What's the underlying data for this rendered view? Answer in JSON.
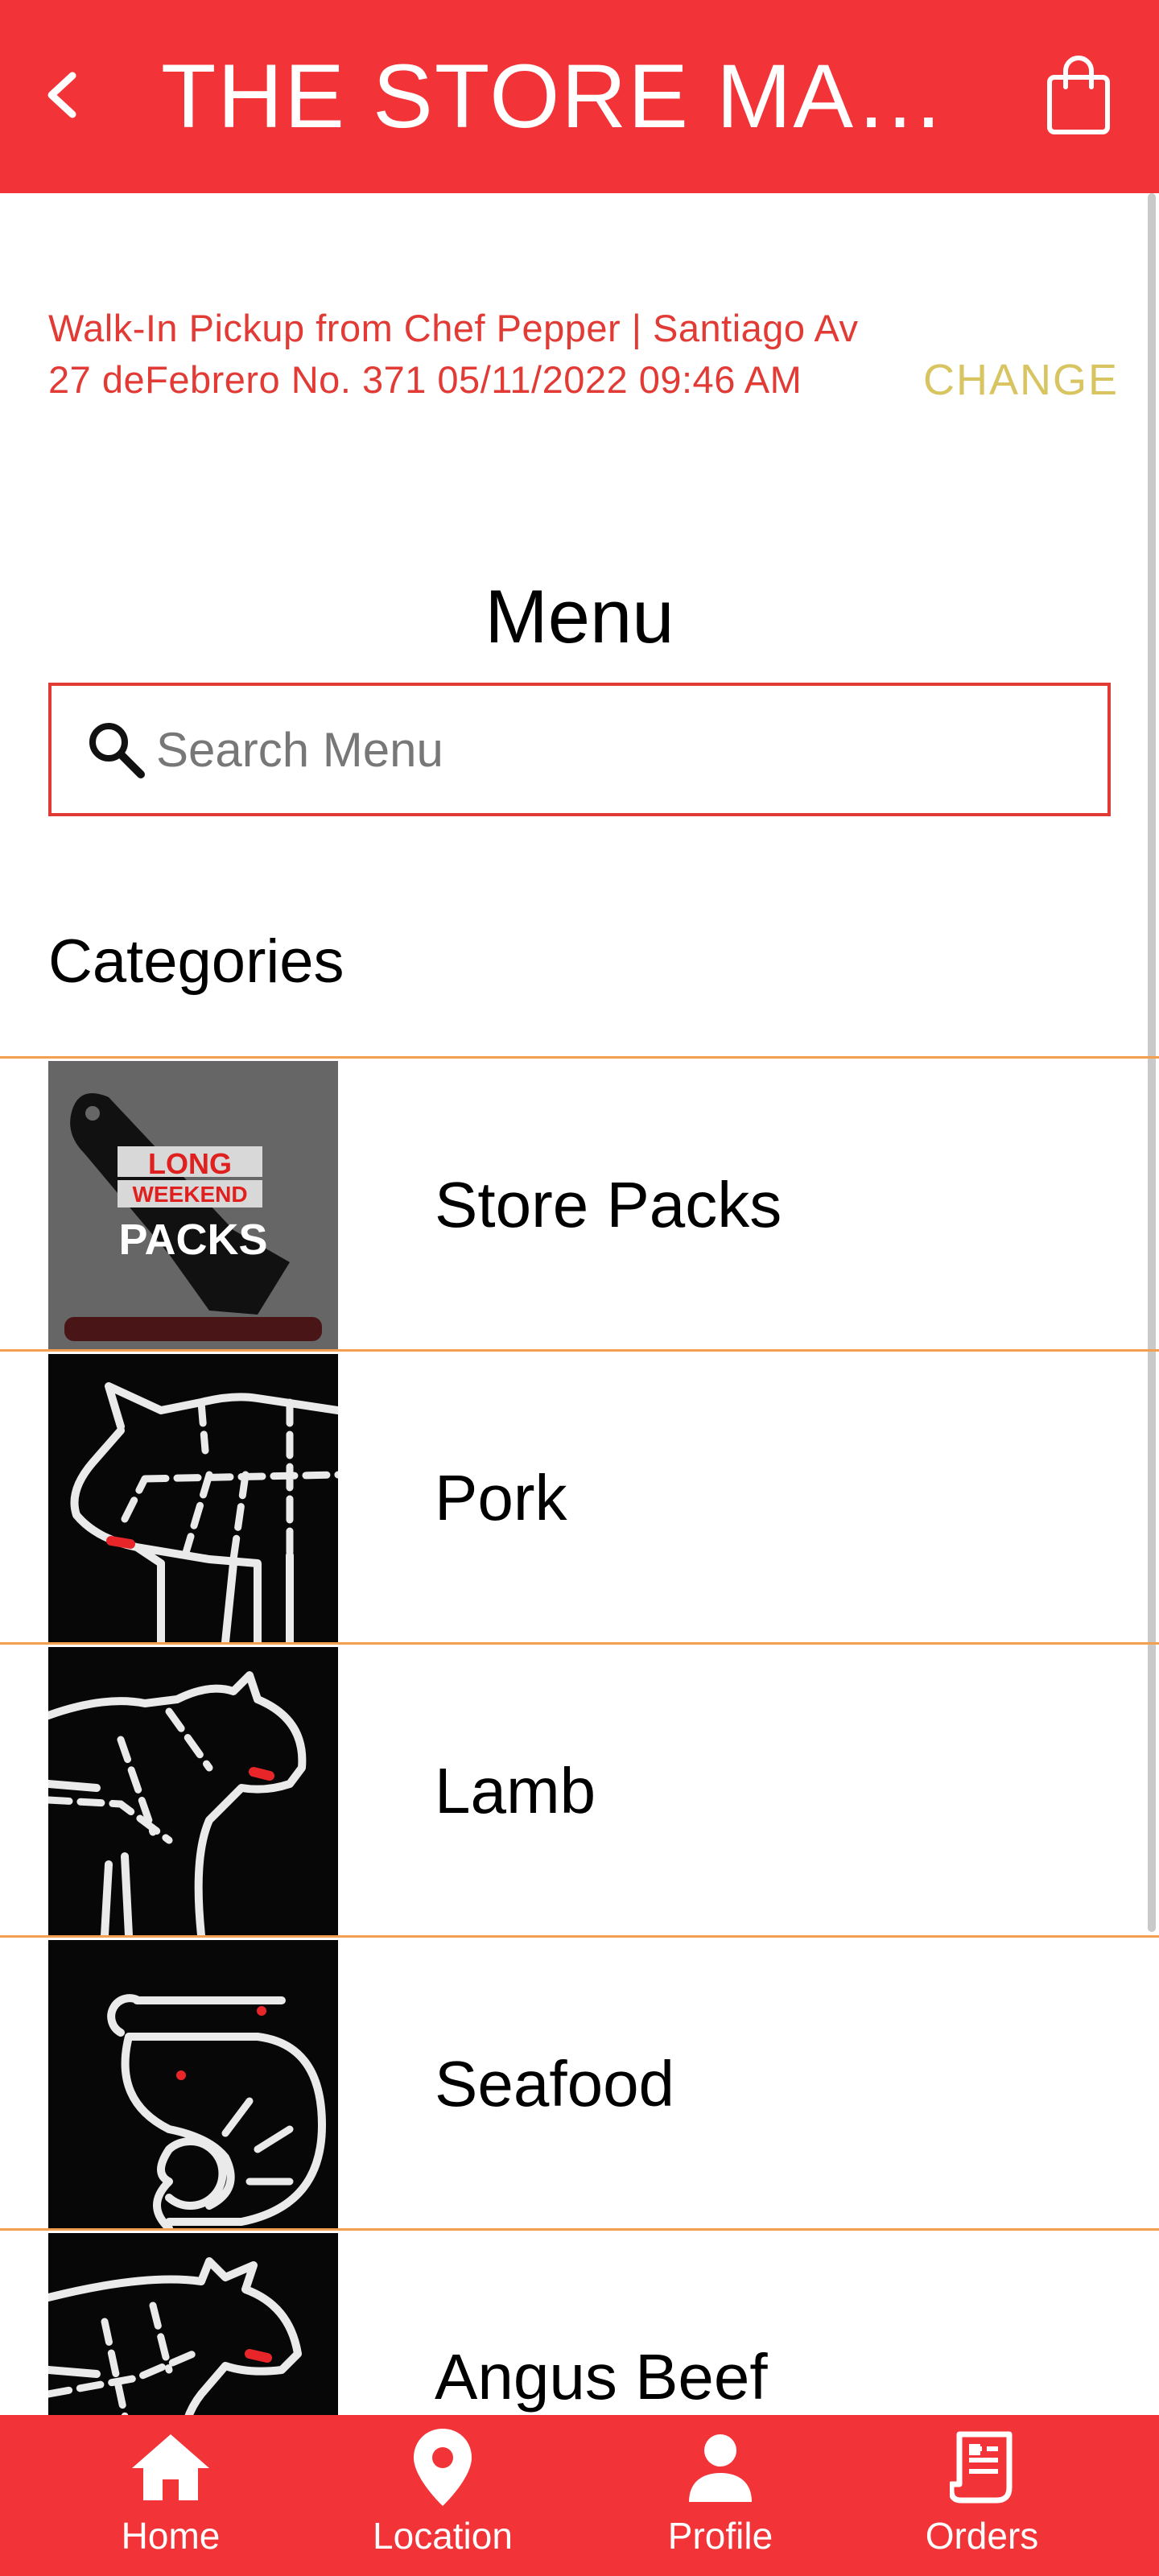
{
  "app_bar": {
    "title": "THE STORE MARKET",
    "back_icon": "chevron-left-icon",
    "cart_icon": "shopping-bag-icon",
    "background": "#F23337"
  },
  "pickup": {
    "text": "Walk-In Pickup from Chef Pepper | Santiago Av 27 deFebrero No. 371 05/11/2022 09:46 AM",
    "change_label": "CHANGE"
  },
  "menu": {
    "heading": "Menu",
    "search_placeholder": "Search Menu",
    "search_value": ""
  },
  "categories": {
    "heading": "Categories",
    "items": [
      {
        "label": "Store Packs",
        "thumb": "long-weekend-packs",
        "thumb_lines": [
          "LONG",
          "WEEKEND",
          "PACKS"
        ]
      },
      {
        "label": "Pork",
        "thumb": "pig-cuts-icon"
      },
      {
        "label": "Lamb",
        "thumb": "lamb-cuts-icon"
      },
      {
        "label": "Seafood",
        "thumb": "shrimp-icon"
      },
      {
        "label": "Angus Beef",
        "thumb": "cow-cuts-icon"
      }
    ]
  },
  "bottom_nav": {
    "items": [
      {
        "label": "Home",
        "icon": "home-icon"
      },
      {
        "label": "Location",
        "icon": "location-pin-icon"
      },
      {
        "label": "Profile",
        "icon": "person-icon"
      },
      {
        "label": "Orders",
        "icon": "receipt-icon"
      }
    ]
  },
  "colors": {
    "primary": "#F23337",
    "accent_text": "#E23A35",
    "change": "#D9C462",
    "divider": "#F2A04F"
  }
}
